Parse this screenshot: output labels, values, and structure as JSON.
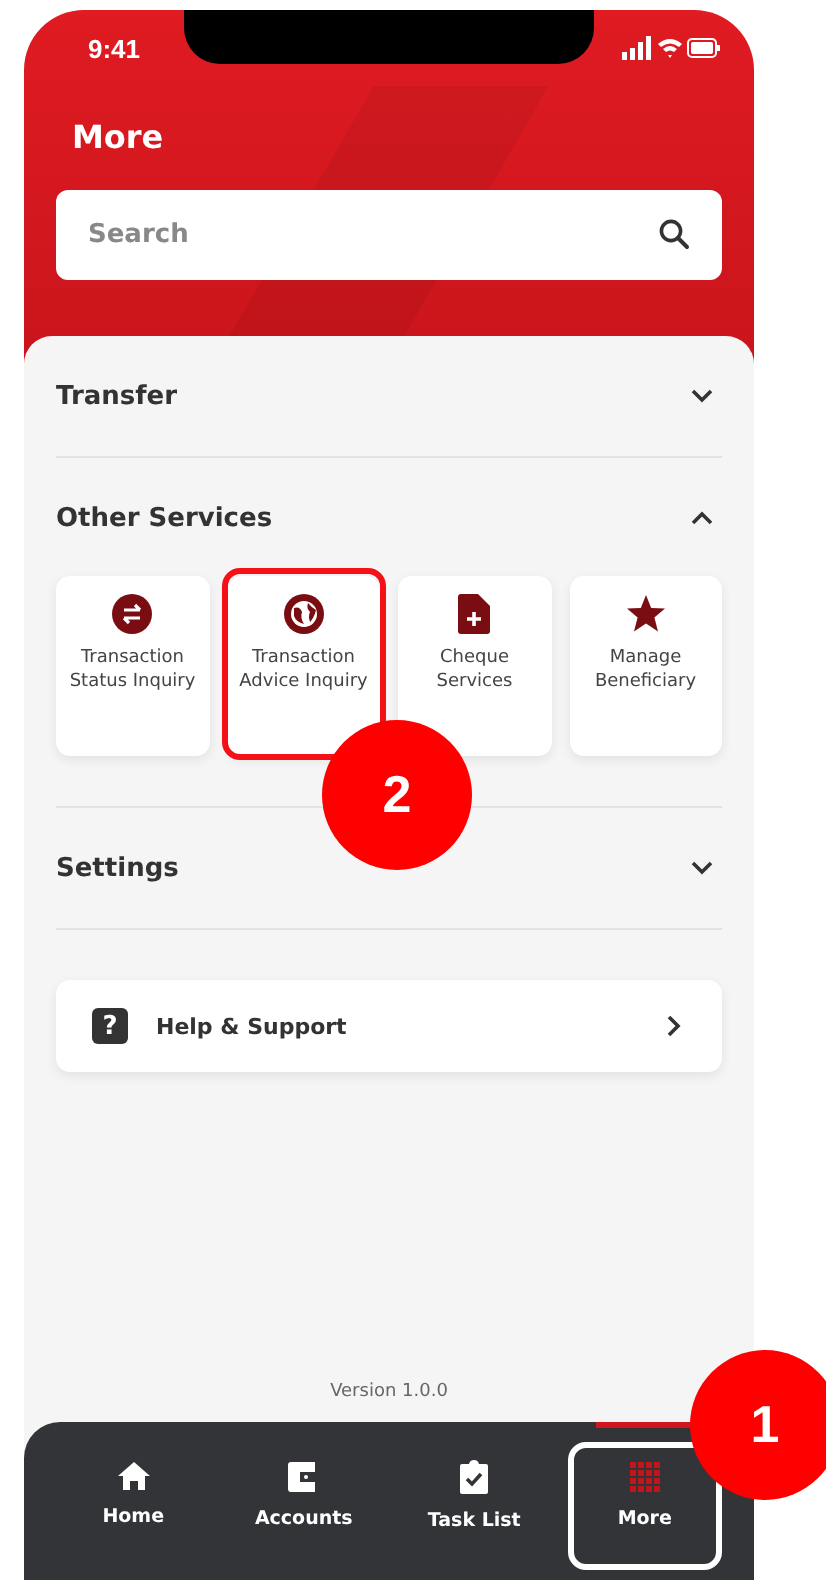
{
  "status_bar": {
    "time": "9:41"
  },
  "header": {
    "title": "More"
  },
  "search": {
    "placeholder": "Search"
  },
  "sections": [
    {
      "title": "Transfer",
      "expanded": false
    },
    {
      "title": "Other Services",
      "expanded": true,
      "tiles": [
        {
          "label": "Transaction Status Inquiry",
          "kind": "swap",
          "highlighted": false
        },
        {
          "label": "Transaction Advice Inquiry",
          "kind": "globe",
          "highlighted": true,
          "step": "2"
        },
        {
          "label": "Cheque Services",
          "kind": "document",
          "highlighted": false
        },
        {
          "label": "Manage Beneficiary",
          "kind": "star",
          "highlighted": false
        }
      ]
    },
    {
      "title": "Settings",
      "expanded": false
    }
  ],
  "help": {
    "glyph": "?",
    "label": "Help & Support"
  },
  "version": "Version 1.0.0",
  "nav": [
    {
      "label": "Home",
      "kind": "home",
      "selected": false,
      "highlighted": false
    },
    {
      "label": "Accounts",
      "kind": "wallet",
      "selected": false,
      "highlighted": false
    },
    {
      "label": "Task List",
      "kind": "clipboard",
      "selected": false,
      "highlighted": false
    },
    {
      "label": "More",
      "kind": "grid",
      "selected": true,
      "highlighted": true,
      "step": "1"
    }
  ]
}
